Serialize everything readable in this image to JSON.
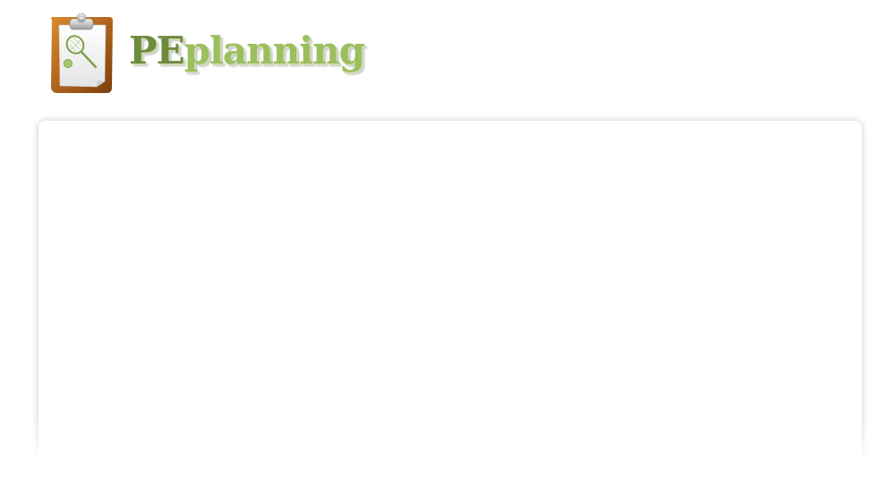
{
  "header": {
    "logo": {
      "text_pe": "PE",
      "text_planning": "planning",
      "icon": "clipboard-tennis-racket-icon"
    }
  },
  "colors": {
    "logo_pe": "#6e8b3d",
    "logo_planning": "#9cbf5e",
    "clipboard_brown": "#b0641c",
    "panel_background": "#ffffff"
  }
}
